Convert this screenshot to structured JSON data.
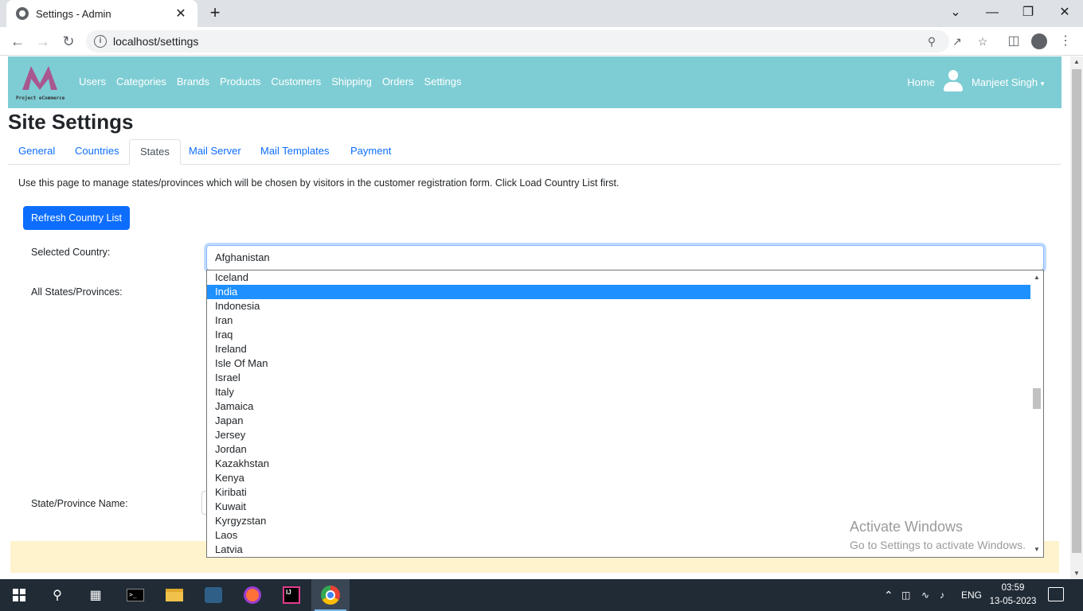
{
  "browser": {
    "tab_title": "Settings - Admin",
    "tab_close": "✕",
    "new_tab": "+",
    "url": "localhost/settings",
    "win_controls": [
      "⌄",
      "—",
      "❐",
      "✕"
    ]
  },
  "app": {
    "logo_caption": "Project eCommerce",
    "nav_links": [
      "Users",
      "Categories",
      "Brands",
      "Products",
      "Customers",
      "Shipping",
      "Orders",
      "Settings"
    ],
    "home": "Home",
    "user_name": "Manjeet Singh",
    "brand_color": "#7ecdd4"
  },
  "page": {
    "title": "Site Settings",
    "tabs": [
      "General",
      "Countries",
      "States",
      "Mail Server",
      "Mail Templates",
      "Payment"
    ],
    "active_tab": "States",
    "description": "Use this page to manage states/provinces which will be chosen by visitors in the customer registration form. Click Load Country List first.",
    "refresh_button": "Refresh Country List",
    "selected_country_label": "Selected Country:",
    "selected_country_value": "Afghanistan",
    "all_states_label": "All States/Provinces:",
    "state_name_label": "State/Province Name:"
  },
  "dropdown": {
    "items": [
      "Iceland",
      "India",
      "Indonesia",
      "Iran",
      "Iraq",
      "Ireland",
      "Isle Of Man",
      "Israel",
      "Italy",
      "Jamaica",
      "Japan",
      "Jersey",
      "Jordan",
      "Kazakhstan",
      "Kenya",
      "Kiribati",
      "Kuwait",
      "Kyrgyzstan",
      "Laos",
      "Latvia"
    ],
    "highlighted": "India"
  },
  "watermark": {
    "line1": "Activate Windows",
    "line2": "Go to Settings to activate Windows."
  },
  "taskbar": {
    "language": "ENG",
    "time": "03:59",
    "date": "13-05-2023"
  }
}
